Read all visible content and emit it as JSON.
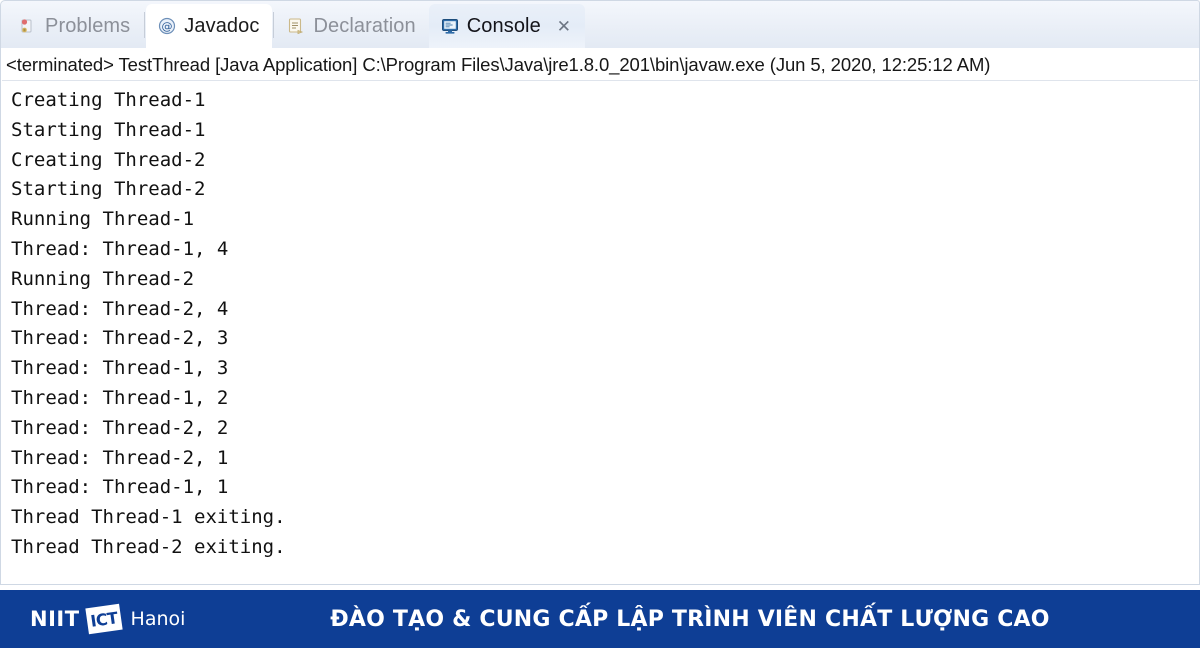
{
  "view": {
    "tabs": [
      {
        "label": "Problems",
        "icon": "problems-icon",
        "state": "inactive"
      },
      {
        "label": "Javadoc",
        "icon": "javadoc-at-icon",
        "state": "hover"
      },
      {
        "label": "Declaration",
        "icon": "declaration-icon",
        "state": "inactive"
      },
      {
        "label": "Console",
        "icon": "console-monitor-icon",
        "state": "active",
        "close_glyph": "✕"
      }
    ]
  },
  "launch": {
    "status": "<terminated>",
    "full_line": "<terminated> TestThread [Java Application] C:\\Program Files\\Java\\jre1.8.0_201\\bin\\javaw.exe (Jun 5, 2020, 12:25:12 AM)",
    "process_name": "TestThread",
    "launch_type": "[Java Application]",
    "vm_path": "C:\\Program Files\\Java\\jre1.8.0_201\\bin\\javaw.exe",
    "timestamp": "(Jun 5, 2020, 12:25:12 AM)"
  },
  "console": {
    "lines": [
      "Creating Thread-1",
      "Starting Thread-1",
      "Creating Thread-2",
      "Starting Thread-2",
      "Running Thread-1",
      "Thread: Thread-1, 4",
      "Running Thread-2",
      "Thread: Thread-2, 4",
      "Thread: Thread-2, 3",
      "Thread: Thread-1, 3",
      "Thread: Thread-1, 2",
      "Thread: Thread-2, 2",
      "Thread: Thread-2, 1",
      "Thread: Thread-1, 1",
      "Thread Thread-1 exiting.",
      "Thread Thread-2 exiting."
    ]
  },
  "footer": {
    "brand_prefix": "NIIT",
    "brand_mark_text": "ICT",
    "brand_suffix": "Hanoi",
    "slogan": "ĐÀO TẠO & CUNG CẤP LẬP TRÌNH VIÊN CHẤT LƯỢNG CAO",
    "background_color": "#0e3e95",
    "text_color": "#ffffff"
  }
}
